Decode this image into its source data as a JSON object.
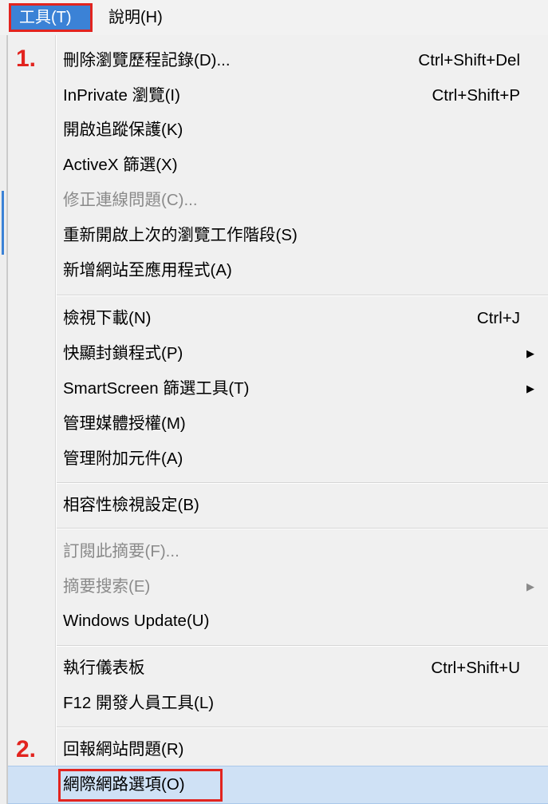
{
  "menubar": {
    "tools": "工具(T)",
    "help": "說明(H)"
  },
  "annotations": {
    "step1": "1.",
    "step2": "2."
  },
  "menu": {
    "items": [
      {
        "label": "刪除瀏覽歷程記錄(D)...",
        "shortcut": "Ctrl+Shift+Del"
      },
      {
        "label": "InPrivate 瀏覽(I)",
        "shortcut": "Ctrl+Shift+P"
      },
      {
        "label": "開啟追蹤保護(K)"
      },
      {
        "label": "ActiveX 篩選(X)"
      },
      {
        "label": "修正連線問題(C)..."
      },
      {
        "label": "重新開啟上次的瀏覽工作階段(S)"
      },
      {
        "label": "新增網站至應用程式(A)"
      },
      {
        "label": "檢視下載(N)",
        "shortcut": "Ctrl+J"
      },
      {
        "label": "快顯封鎖程式(P)"
      },
      {
        "label": "SmartScreen 篩選工具(T)"
      },
      {
        "label": "管理媒體授權(M)"
      },
      {
        "label": "管理附加元件(A)"
      },
      {
        "label": "相容性檢視設定(B)"
      },
      {
        "label": "訂閱此摘要(F)..."
      },
      {
        "label": "摘要搜索(E)"
      },
      {
        "label": "Windows Update(U)"
      },
      {
        "label": "執行儀表板",
        "shortcut": "Ctrl+Shift+U"
      },
      {
        "label": "F12 開發人員工具(L)"
      },
      {
        "label": "回報網站問題(R)"
      },
      {
        "label": "網際網路選項(O)"
      }
    ],
    "submenu_arrow": "▶"
  },
  "colors": {
    "accent": "#3b82d6",
    "annotation_red": "#e2241f",
    "disabled_text": "#8a8a8a",
    "highlight": "#cfe1f5"
  }
}
